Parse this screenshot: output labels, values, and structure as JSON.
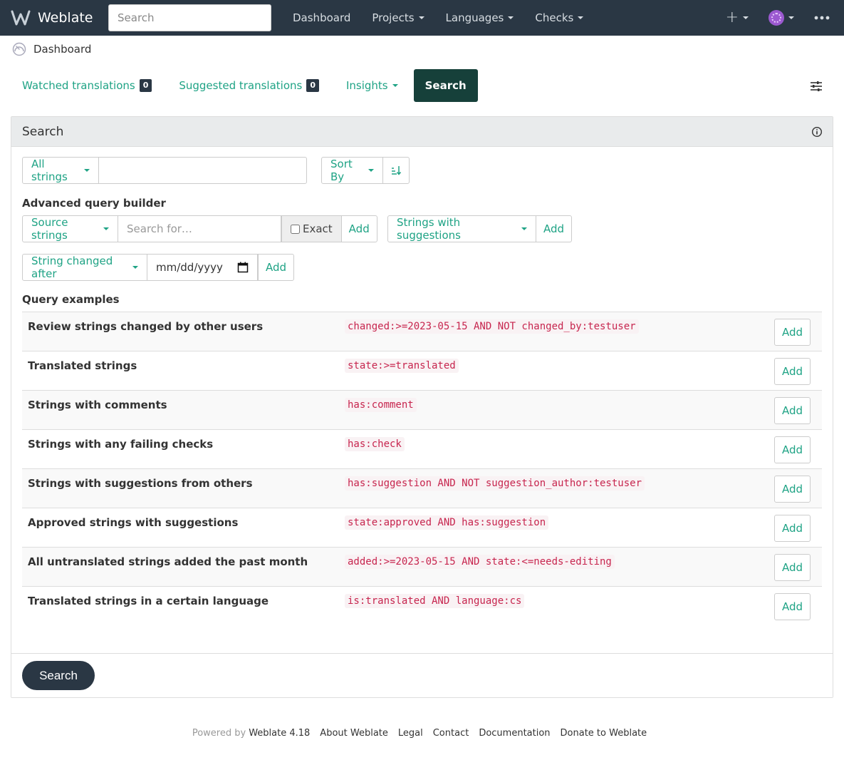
{
  "navbar": {
    "brand": "Weblate",
    "search_placeholder": "Search",
    "links": [
      {
        "label": "Dashboard"
      },
      {
        "label": "Projects"
      },
      {
        "label": "Languages"
      },
      {
        "label": "Checks"
      }
    ],
    "icons": [
      "weblate-logo-icon",
      "plus-icon",
      "avatar",
      "more-dots-icon"
    ]
  },
  "breadcrumb": {
    "label": "Dashboard",
    "icon": "dashboard-icon"
  },
  "tabs": {
    "watched": {
      "label": "Watched translations",
      "count": "0"
    },
    "suggested": {
      "label": "Suggested translations",
      "count": "0"
    },
    "insights": {
      "label": "Insights"
    },
    "search": {
      "label": "Search"
    }
  },
  "panel": {
    "title": "Search",
    "filter_dropdown": "All strings",
    "sort_by": "Sort By",
    "advanced_title": "Advanced query builder",
    "source_dropdown": "Source strings",
    "search_placeholder": "Search for…",
    "exact_label": "Exact",
    "add_label": "Add",
    "suggestions_dropdown": "Strings with suggestions",
    "changed_dropdown": "String changed after",
    "date_placeholder": "mm/dd/yyyy",
    "examples_title": "Query examples",
    "examples": [
      {
        "label": "Review strings changed by other users",
        "query": "changed:>=2023-05-15 AND NOT changed_by:testuser",
        "add": "Add"
      },
      {
        "label": "Translated strings",
        "query": "state:>=translated",
        "add": "Add"
      },
      {
        "label": "Strings with comments",
        "query": "has:comment",
        "add": "Add"
      },
      {
        "label": "Strings with any failing checks",
        "query": "has:check",
        "add": "Add"
      },
      {
        "label": "Strings with suggestions from others",
        "query": "has:suggestion AND NOT suggestion_author:testuser",
        "add": "Add"
      },
      {
        "label": "Approved strings with suggestions",
        "query": "state:approved AND has:suggestion",
        "add": "Add"
      },
      {
        "label": "All untranslated strings added the past month",
        "query": "added:>=2023-05-15 AND state:<=needs-editing",
        "add": "Add"
      },
      {
        "label": "Translated strings in a certain language",
        "query": "is:translated AND language:cs",
        "add": "Add"
      }
    ],
    "submit_label": "Search"
  },
  "footer": {
    "powered_by": "Powered by",
    "links": [
      "Weblate 4.18",
      "About Weblate",
      "Legal",
      "Contact",
      "Documentation",
      "Donate to Weblate"
    ]
  },
  "colors": {
    "navbar": "#2a3744",
    "accent": "#1fa385",
    "active_tab": "#16403a",
    "code": "#c7254e"
  }
}
